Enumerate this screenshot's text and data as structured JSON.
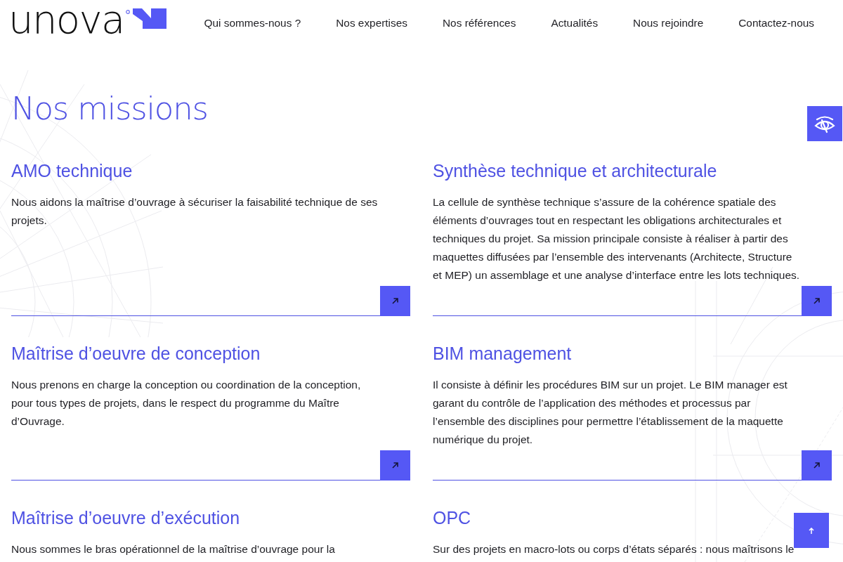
{
  "header": {
    "logo": "unova",
    "nav": [
      {
        "label": "Qui sommes-nous ?"
      },
      {
        "label": "Nos expertises"
      },
      {
        "label": "Nos références"
      },
      {
        "label": "Actualités"
      },
      {
        "label": "Nous rejoindre"
      },
      {
        "label": "Contactez-nous"
      }
    ]
  },
  "page_title": "Nos missions",
  "missions": [
    {
      "kind": "full",
      "title": "AMO technique",
      "text": "Nous aidons la maîtrise d’ouvrage à sécuriser la faisabilité technique de ses projets."
    },
    {
      "kind": "full",
      "title": "Synthèse technique et architecturale",
      "text": "La cellule de synthèse technique s’assure de la cohérence spatiale des éléments d’ouvrages tout en respectant les obligations architecturales et techniques du projet. Sa mission principale consiste à réaliser à partir des maquettes diffusées par l’ensemble des intervenants (Architecte, Structure et MEP) un assemblage et une analyse d’interface entre les lots techniques."
    },
    {
      "kind": "full",
      "title": "Maîtrise d’oeuvre de conception",
      "text": "Nous prenons en charge la conception ou coordination de la conception, pour tous types de projets, dans le respect du programme du Maître d’Ouvrage."
    },
    {
      "kind": "full",
      "title": "BIM management",
      "text": "Il consiste à définir les procédures BIM sur un projet. Le BIM manager est garant du contrôle de l’application des méthodes et processus par l’ensemble des disciplines pour permettre l’établissement de la maquette numérique du projet."
    },
    {
      "kind": "cut",
      "title": "Maîtrise d’oeuvre d’exécution",
      "text": "Nous sommes le bras opérationnel de la maîtrise d’ouvrage pour la"
    },
    {
      "kind": "cut",
      "title": "OPC",
      "text": "Sur des projets en macro-lots ou corps d’états séparés : nous maîtrisons le"
    }
  ]
}
